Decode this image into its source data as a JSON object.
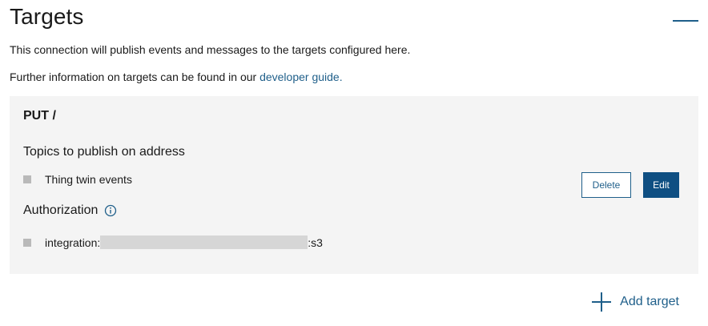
{
  "header": {
    "title": "Targets"
  },
  "intro": {
    "line1": "This connection will publish events and messages to the targets configured here.",
    "line2_prefix": "Further information on targets can be found in our ",
    "line2_link": "developer guide."
  },
  "target": {
    "title": "PUT /",
    "topics_heading": "Topics to publish on address",
    "topics": [
      "Thing twin events"
    ],
    "authorization_heading": "Authorization",
    "authorization": {
      "prefix": "integration:",
      "suffix": ":s3"
    },
    "delete_label": "Delete",
    "edit_label": "Edit"
  },
  "actions": {
    "add_target_label": "Add target"
  },
  "icons": {
    "collapse": "minus-collapse-icon",
    "info": "info-icon",
    "add": "plus-icon"
  },
  "colors": {
    "accent": "#1f5f8a",
    "primary_button": "#0f4f82",
    "card_background": "#f4f4f4",
    "bullet": "#b9b9b9"
  }
}
